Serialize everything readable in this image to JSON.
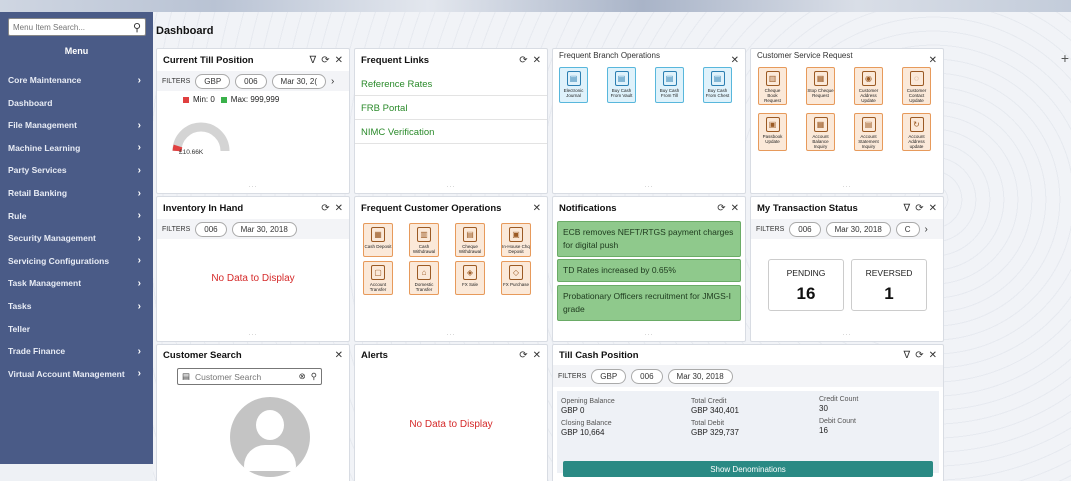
{
  "sidebar": {
    "search_placeholder": "Menu Item Search...",
    "menu_title": "Menu",
    "items": [
      {
        "label": "Core Maintenance",
        "chevron": true
      },
      {
        "label": "Dashboard",
        "chevron": false
      },
      {
        "label": "File Management",
        "chevron": true
      },
      {
        "label": "Machine Learning",
        "chevron": true
      },
      {
        "label": "Party Services",
        "chevron": true
      },
      {
        "label": "Retail Banking",
        "chevron": true
      },
      {
        "label": "Rule",
        "chevron": true
      },
      {
        "label": "Security Management",
        "chevron": true
      },
      {
        "label": "Servicing Configurations",
        "chevron": true
      },
      {
        "label": "Task Management",
        "chevron": true
      },
      {
        "label": "Tasks",
        "chevron": true
      },
      {
        "label": "Teller",
        "chevron": false
      },
      {
        "label": "Trade Finance",
        "chevron": true
      },
      {
        "label": "Virtual Account Management",
        "chevron": true
      }
    ]
  },
  "page_title": "Dashboard",
  "till": {
    "title": "Current Till Position",
    "filters_label": "FILTERS",
    "f1": "GBP",
    "f2": "006",
    "f3": "Mar 30, 2(",
    "min": "Min: 0",
    "max": "Max: 999,999",
    "gauge_value": "£10.66K"
  },
  "links": {
    "title": "Frequent Links",
    "items": [
      "Reference Rates",
      "FRB Portal",
      "NIMC Verification"
    ]
  },
  "fbo": {
    "title": "Frequent Branch Operations",
    "tiles": [
      "Electronic Journal",
      "Buy Cash From Vault",
      "Buy Cash From Till",
      "Buy Cash From Chest"
    ]
  },
  "csr": {
    "title": "Customer Service Request",
    "tiles": [
      "Cheque Book Request",
      "Stop Cheque Request",
      "Customer Address Update",
      "Customer Contact Update",
      "Passbook Update",
      "Account Balance Inquiry",
      "Account Statement Inquiry",
      "Account Address update"
    ]
  },
  "inv": {
    "title": "Inventory In Hand",
    "filters_label": "FILTERS",
    "f1": "006",
    "f2": "Mar 30, 2018",
    "nodata": "No Data to Display"
  },
  "fco": {
    "title": "Frequent Customer Operations",
    "tiles": [
      "Cash Deposit",
      "Cash Withdrawal",
      "Cheque Withdrawal",
      "In-House Chq Deposit",
      "Account Transfer",
      "Domestic Transfer",
      "FX Sale",
      "FX Purchase"
    ]
  },
  "notif": {
    "title": "Notifications",
    "items": [
      "ECB removes NEFT/RTGS payment charges for digital push",
      "TD Rates increased by 0.65%",
      "Probationary Officers recruitment for JMGS-I grade"
    ]
  },
  "mts": {
    "title": "My Transaction Status",
    "filters_label": "FILTERS",
    "f1": "006",
    "f2": "Mar 30, 2018",
    "f3": "C",
    "pending_label": "PENDING",
    "pending_value": "16",
    "reversed_label": "REVERSED",
    "reversed_value": "1"
  },
  "cs": {
    "title": "Customer Search",
    "placeholder": "Customer Search"
  },
  "alerts": {
    "title": "Alerts",
    "nodata": "No Data to Display"
  },
  "tcp": {
    "title": "Till Cash Position",
    "filters_label": "FILTERS",
    "f1": "GBP",
    "f2": "006",
    "f3": "Mar 30, 2018",
    "opening_label": "Opening Balance",
    "opening_value": "GBP 0",
    "credit_label": "Total Credit",
    "credit_value": "GBP 340,401",
    "ccount_label": "Credit Count",
    "ccount_value": "30",
    "closing_label": "Closing Balance",
    "closing_value": "GBP 10,664",
    "debit_label": "Total Debit",
    "debit_value": "GBP 329,737",
    "dcount_label": "Debit Count",
    "dcount_value": "16",
    "button": "Show Denominations"
  },
  "colors": {
    "sidebar": "#4a5b87",
    "link_green": "#2a8a2a",
    "nodata_red": "#d52a2a",
    "notif_green": "#8fc98c",
    "button_teal": "#2a8a84"
  }
}
